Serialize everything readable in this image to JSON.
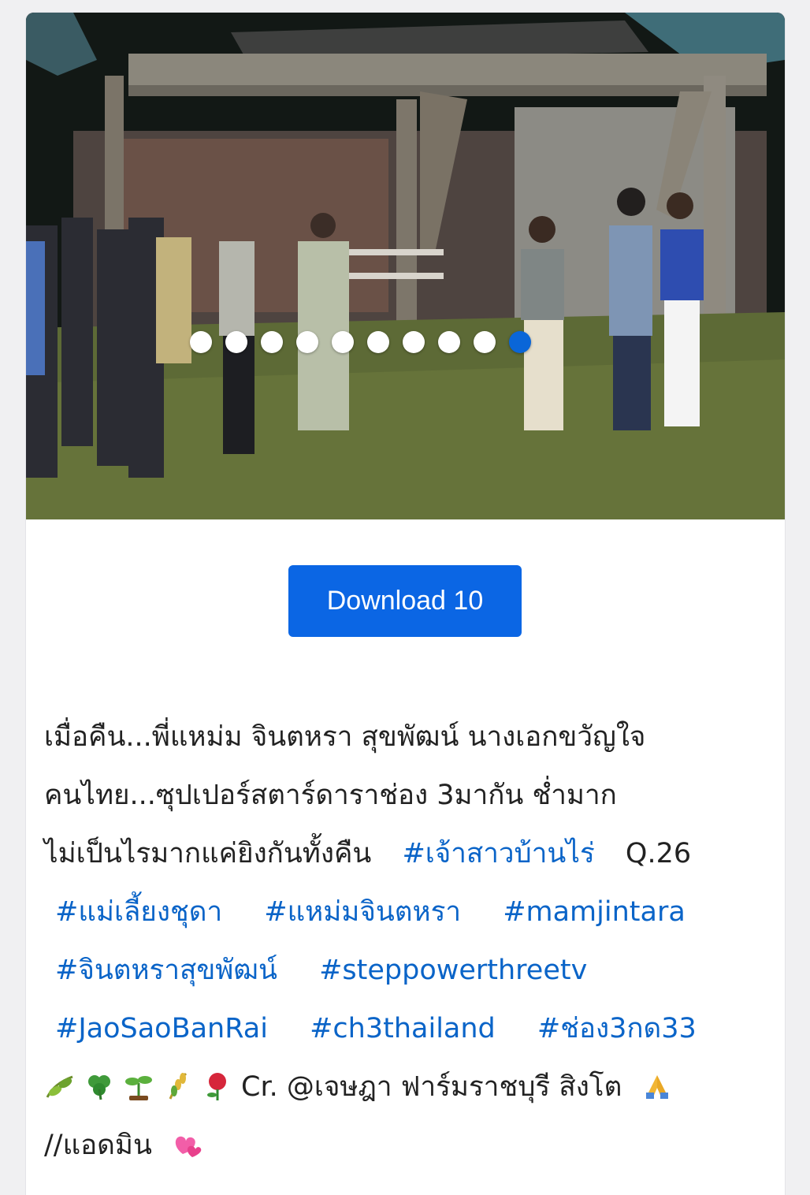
{
  "post": {
    "image": {
      "alt_icon": "photo",
      "slide_count": 10,
      "active_slide": 10
    },
    "download_label": "Download 10",
    "caption": {
      "line1": "เมื่อคืน...พี่แหม่ม จินตหรา สุขพัฒน์ นางเอกขวัญใจ",
      "line2": "คนไทย...ซุปเปอร์สตาร์ดาราช่อง 3มากัน ช่ำมาก",
      "line3_text": "ไม่เป็นไรมากแค่ยิงกันทั้งคืน",
      "hashtag1": "#เจ้าสาวบ้านไร่",
      "line3_suffix": "Q.26",
      "hashtag2": "#แม่เลี้ยงชุดา",
      "hashtag3": "#แหม่มจินตหรา",
      "hashtag4": "#mamjintara",
      "hashtag5": "#จินตหราสุขพัฒน์",
      "hashtag6": "#steppowerthreetv",
      "hashtag7": "#JaoSaoBanRai",
      "hashtag8": "#ch3thailand",
      "hashtag9": "#ช่อง3กด33",
      "emoji_icons": [
        "herb-icon",
        "clover-icon",
        "seedling-icon",
        "rice-icon",
        "rose-icon"
      ],
      "credit": "Cr. @เจษฎา ฟาร์มราชบุรี สิงโต",
      "pray_icon": "pray-icon",
      "admin": "//แอดมิน",
      "heart_icon": "heart-icon"
    }
  },
  "colors": {
    "accent": "#0b66e4",
    "hashtag": "#0a64c8",
    "active_dot": "#0a66d8"
  }
}
